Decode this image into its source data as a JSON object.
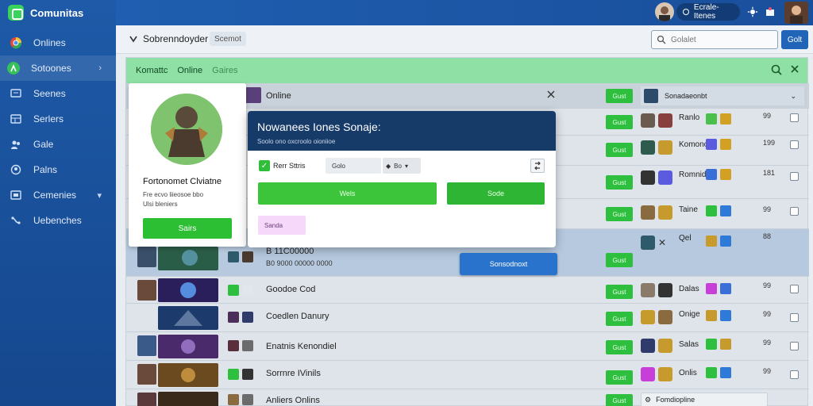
{
  "app": {
    "name": "Comunitas"
  },
  "sidebar": {
    "items": [
      {
        "label": "Onlines",
        "icon": "chrome-icon"
      },
      {
        "label": "Sotoones",
        "icon": "users-icon",
        "active": true
      },
      {
        "label": "Seenes",
        "icon": "monitor-icon"
      },
      {
        "label": "Serlers",
        "icon": "grid-icon"
      },
      {
        "label": "Gale",
        "icon": "people-icon"
      },
      {
        "label": "Palns",
        "icon": "user-icon"
      },
      {
        "label": "Cemenies",
        "icon": "screen-icon"
      },
      {
        "label": "Uebenches",
        "icon": "link-icon"
      }
    ]
  },
  "topbar": {
    "user_label": "Ecrale-Itenes"
  },
  "toolbar": {
    "title": "Sobrenndoyder",
    "filter": "Scemot",
    "search_placeholder": "Golalet",
    "search_button": "Golt"
  },
  "panel": {
    "tabs": [
      "Komattc",
      "Online",
      "Gaires"
    ],
    "header_row": {
      "title": "Online",
      "right_label": "Sonadaeonbt"
    }
  },
  "rows": [
    {
      "title": "",
      "btn": "Gust",
      "name": "Ranlo",
      "num": "99"
    },
    {
      "title": "",
      "btn": "Gust",
      "name": "Komonor",
      "num": "199"
    },
    {
      "title": "",
      "btn": "Gust",
      "name": "Romnidos",
      "num": "181"
    },
    {
      "title": "",
      "btn": "Gust",
      "name": "Taine",
      "num": "99"
    },
    {
      "title": "B 11C00000",
      "sub": "B0 9000 00000 0000",
      "btn": "Gust",
      "name": "Qel",
      "num": "88"
    },
    {
      "title": "Goodoe Cod",
      "btn": "Gust",
      "name": "Dalas",
      "num": "99"
    },
    {
      "title": "Coedlen Danury",
      "btn": "Gust",
      "name": "Onige",
      "num": "99"
    },
    {
      "title": "Enatnis Kenondiel",
      "btn": "Gust",
      "name": "Salas",
      "num": "99"
    },
    {
      "title": "Sorrnre IVinils",
      "btn": "Gust",
      "name": "Onlis",
      "num": "99"
    },
    {
      "title": "Anliers Onlins",
      "btn": "Gust",
      "name": "Fomdiopline",
      "num": ""
    }
  ],
  "card": {
    "name": "Fortonomet Clviatne",
    "sub1": "Fre ecvo liieosoe bbo",
    "sub2": "Ulsi bleniers",
    "button": "Sairs"
  },
  "modal": {
    "title": "Nowanees Iones Sonaje:",
    "subtitle": "Soolo ono oxcroolo oioniioe",
    "checkbox_label": "Rerr Sttris",
    "field1": "Golo",
    "field2": "Bo",
    "button1": "Wels",
    "button2": "Sode",
    "tag": "Sanda"
  },
  "blue_action": "Sonsodnoxt",
  "colors": {
    "accent_green": "#2fbf3f",
    "sidebar_blue": "#1e5aa8",
    "header_green": "#8fe0a4"
  }
}
